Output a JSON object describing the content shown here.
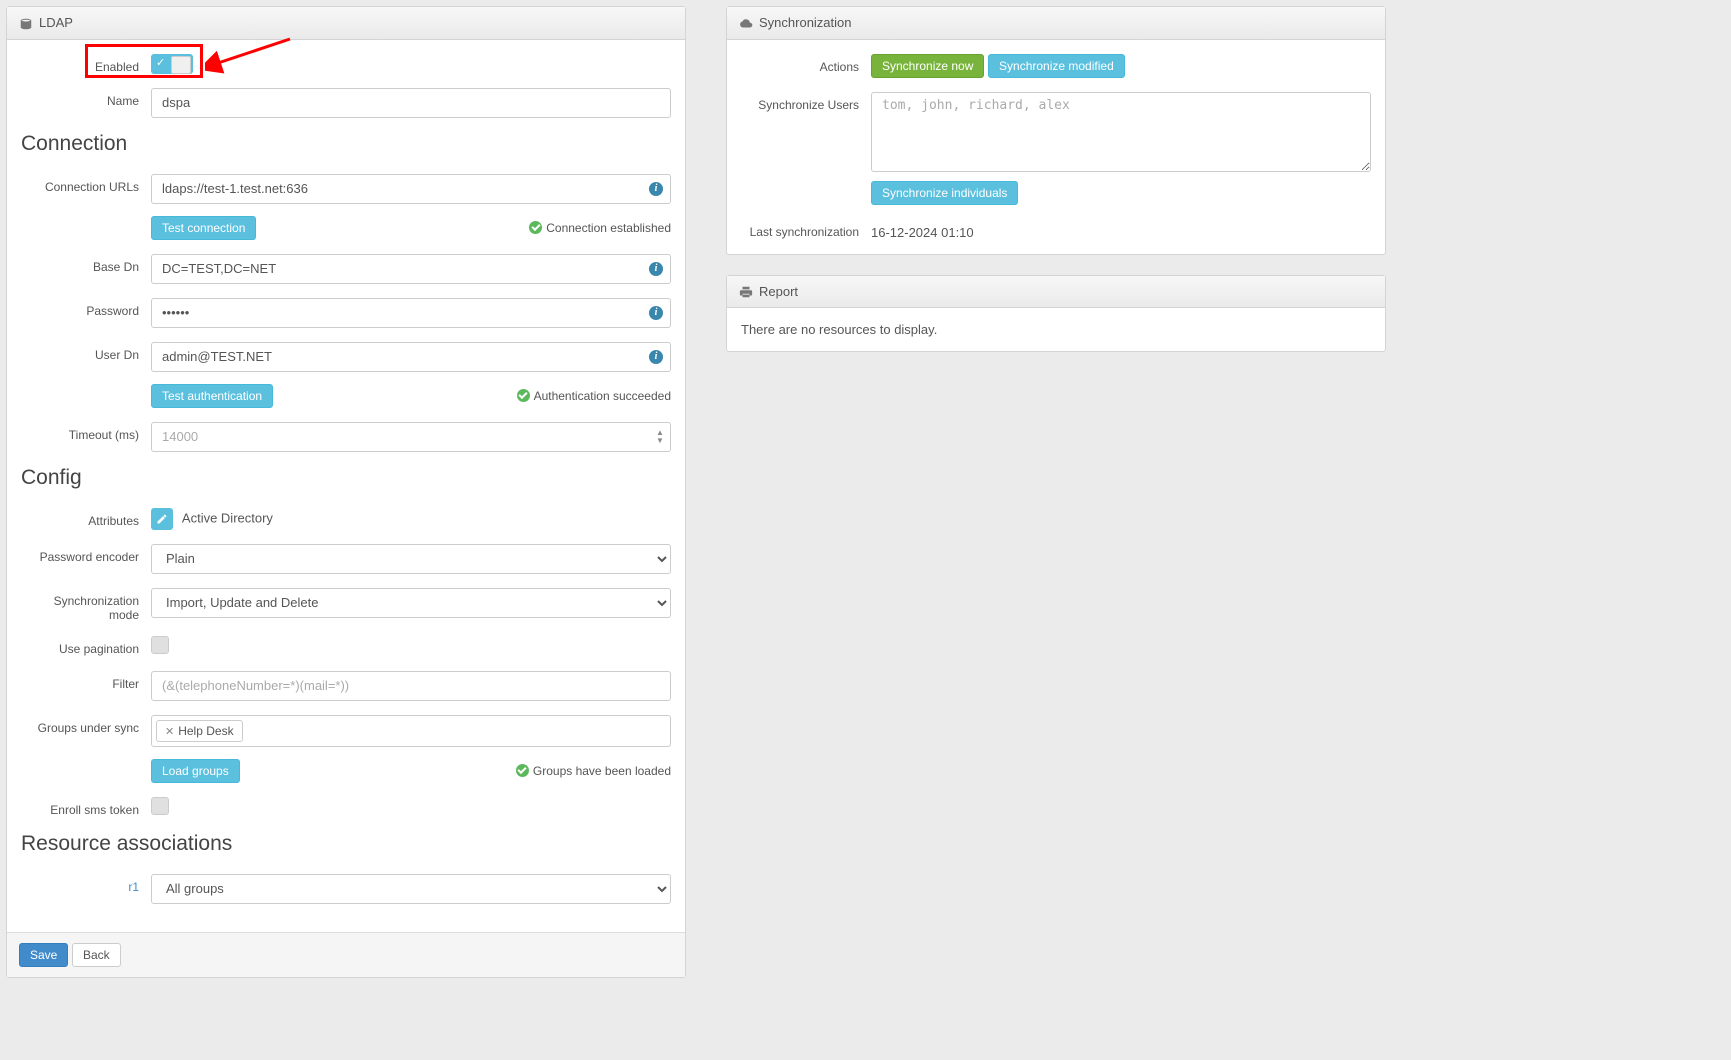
{
  "ldap": {
    "panel_title": "LDAP",
    "enabled_label": "Enabled",
    "name_label": "Name",
    "name_value": "dspa",
    "connection_title": "Connection",
    "connection_urls_label": "Connection URLs",
    "connection_urls_value": "ldaps://test-1.test.net:636",
    "test_connection_btn": "Test connection",
    "connection_status": "Connection established",
    "base_dn_label": "Base Dn",
    "base_dn_value": "DC=TEST,DC=NET",
    "password_label": "Password",
    "password_value": "••••••",
    "user_dn_label": "User Dn",
    "user_dn_value": "admin@TEST.NET",
    "test_auth_btn": "Test authentication",
    "auth_status": "Authentication succeeded",
    "timeout_label": "Timeout (ms)",
    "timeout_value": "14000",
    "config_title": "Config",
    "attributes_label": "Attributes",
    "attributes_value": "Active Directory",
    "pwd_encoder_label": "Password encoder",
    "pwd_encoder_value": "Plain",
    "sync_mode_label": "Synchronization mode",
    "sync_mode_value": "Import, Update and Delete",
    "use_pagination_label": "Use pagination",
    "filter_label": "Filter",
    "filter_placeholder": "(&(telephoneNumber=*)(mail=*))",
    "groups_sync_label": "Groups under sync",
    "groups_sync_tag": "Help Desk",
    "load_groups_btn": "Load groups",
    "groups_status": "Groups have been loaded",
    "enroll_sms_label": "Enroll sms token",
    "resource_assoc_title": "Resource associations",
    "r1_label": "r1",
    "r1_value": "All groups",
    "save_btn": "Save",
    "back_btn": "Back"
  },
  "sync": {
    "panel_title": "Synchronization",
    "actions_label": "Actions",
    "sync_now_btn": "Synchronize now",
    "sync_modified_btn": "Synchronize modified",
    "sync_users_label": "Synchronize Users",
    "sync_users_placeholder": "tom, john, richard, alex",
    "sync_individuals_btn": "Synchronize individuals",
    "last_sync_label": "Last synchronization",
    "last_sync_value": "16-12-2024 01:10"
  },
  "report": {
    "panel_title": "Report",
    "empty_text": "There are no resources to display."
  }
}
